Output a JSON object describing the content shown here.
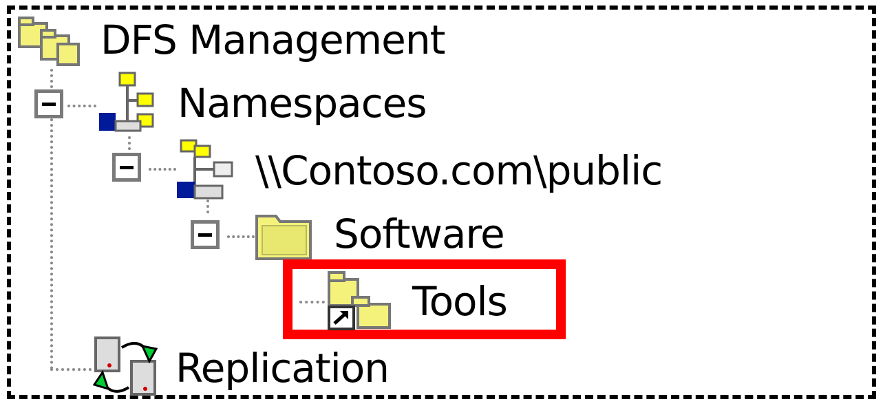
{
  "tree": {
    "root": {
      "label": "DFS Management",
      "icon": "dfs-management-icon"
    },
    "namespaces": {
      "label": "Namespaces",
      "icon": "namespaces-icon",
      "expanded": true
    },
    "namespace_root": {
      "label": "\\\\Contoso.com\\public",
      "icon": "namespace-icon",
      "expanded": true
    },
    "software": {
      "label": "Software",
      "icon": "folder-icon",
      "expanded": true
    },
    "tools": {
      "label": "Tools",
      "icon": "folder-target-icon",
      "highlighted": true
    },
    "replication": {
      "label": "Replication",
      "icon": "replication-icon"
    }
  },
  "colors": {
    "highlight": "#ff0000",
    "folder": "#f0f060",
    "tree_line": "#8a8a8a"
  }
}
